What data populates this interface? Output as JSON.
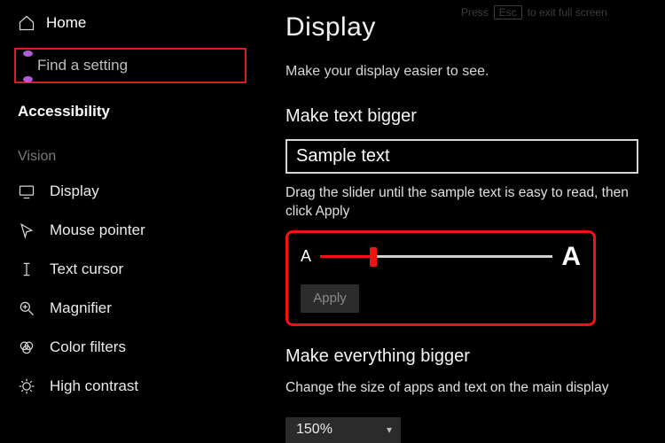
{
  "fs_hint": {
    "pre": "Press",
    "key": "Esc",
    "post": "to exit full screen"
  },
  "sidebar": {
    "home": "Home",
    "search_placeholder": "Find a setting",
    "section": "Accessibility",
    "group": "Vision",
    "items": [
      {
        "id": "display",
        "label": "Display"
      },
      {
        "id": "mouse-pointer",
        "label": "Mouse pointer"
      },
      {
        "id": "text-cursor",
        "label": "Text cursor"
      },
      {
        "id": "magnifier",
        "label": "Magnifier"
      },
      {
        "id": "color-filters",
        "label": "Color filters"
      },
      {
        "id": "high-contrast",
        "label": "High contrast"
      }
    ]
  },
  "main": {
    "title": "Display",
    "subtitle": "Make your display easier to see.",
    "text_bigger": {
      "heading": "Make text bigger",
      "sample": "Sample text",
      "help": "Drag the slider until the sample text is easy to read, then click Apply",
      "small_a": "A",
      "large_a": "A",
      "apply": "Apply",
      "slider_percent": 23
    },
    "everything_bigger": {
      "heading": "Make everything bigger",
      "help": "Change the size of apps and text on the main display",
      "value": "150%"
    }
  }
}
